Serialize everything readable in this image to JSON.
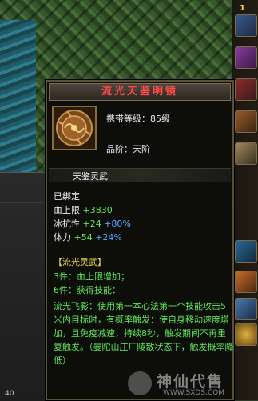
{
  "tooltip": {
    "title": "流光天鉴明镜",
    "requirement_label": "携带等级：",
    "requirement_value": "85级",
    "grade_label": "品阶：",
    "grade_value": "天阶",
    "subtitle": "天鉴灵武",
    "bound": "已绑定",
    "stats": [
      {
        "name": "血上限",
        "value": "+3830",
        "bonus": ""
      },
      {
        "name": "冰抗性",
        "value": "+24",
        "bonus": "+80%"
      },
      {
        "name": "体力",
        "value": "+54",
        "bonus": "+24%"
      }
    ],
    "set_title": "【流光灵武】",
    "set_lines": [
      "3件：血上限增加；",
      "6件：获得技能："
    ],
    "skill_desc": "流光飞影：使用第一本心法第一个技能攻击5米内目标时，有概率触发：使自身移动速度增加，且免疫减速，持续8秒，触发期间不再重复触发。（曼陀山庄厂陵散状态下，触发概率降低）"
  },
  "left_panel": {
    "tab_label": "40"
  },
  "hud": {
    "ticker": "1"
  },
  "watermark": {
    "text": "神仙代售",
    "url": "WWW.SXDS.COM"
  },
  "colors": {
    "title": "#ff4a4a",
    "green": "#5ee85a",
    "blue": "#55aaff",
    "gold": "#e8d64a"
  }
}
